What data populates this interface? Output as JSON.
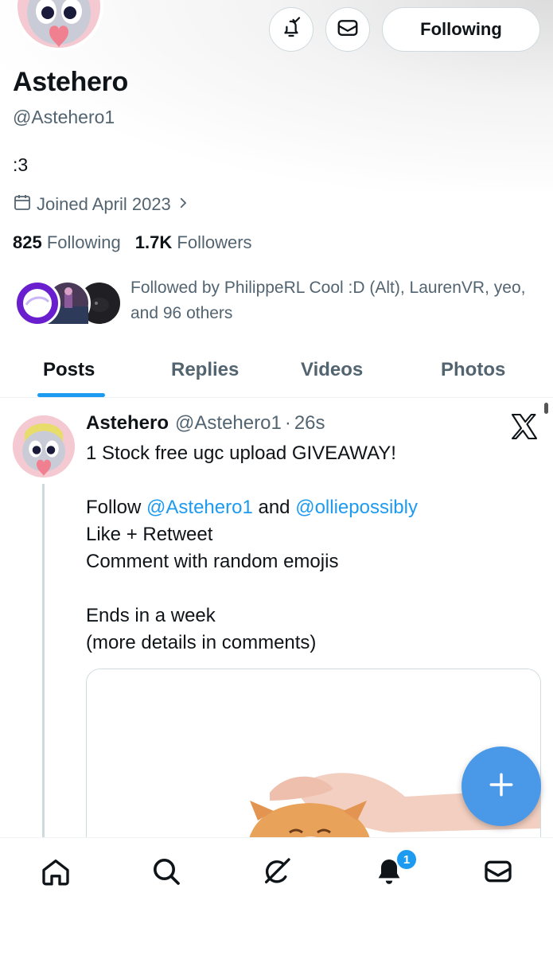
{
  "profile": {
    "name": "Astehero",
    "handle": "@Astehero1",
    "bio": ":3",
    "joined": "Joined April 2023",
    "following_count": "825",
    "following_label": "Following",
    "followers_count": "1.7K",
    "followers_label": "Followers",
    "followed_by": "Followed by PhilippeRL Cool :D (Alt), LaurenVR, yeo, and 96 others"
  },
  "actions": {
    "follow_label": "Following"
  },
  "tabs": [
    {
      "label": "Posts",
      "active": true
    },
    {
      "label": "Replies",
      "active": false
    },
    {
      "label": "Videos",
      "active": false
    },
    {
      "label": "Photos",
      "active": false
    }
  ],
  "post": {
    "author": "Astehero",
    "handle": "@Astehero1",
    "separator": "·",
    "time": "26s",
    "line1": "1 Stock free ugc upload GIVEAWAY!",
    "follow_word": "Follow ",
    "mention1": "@Astehero1",
    "and_word": " and ",
    "mention2": "@olliepossibly",
    "line3": "Like + Retweet",
    "line4": "Comment with random emojis",
    "line5": "Ends in a week",
    "line6": "(more details in comments)"
  },
  "notifications": {
    "badge_count": "1"
  },
  "colors": {
    "accent": "#1d9bf0",
    "fab": "#4a99e9",
    "secondary_text": "#536471",
    "border": "#cfd9de"
  },
  "icons": {
    "notify": "bell-check-icon",
    "message": "envelope-icon",
    "calendar": "calendar-icon",
    "nav": [
      "home-icon",
      "search-icon",
      "grok-icon",
      "bell-icon",
      "envelope-icon"
    ],
    "fab": "plus-icon",
    "post_source": "x-logo-icon"
  }
}
